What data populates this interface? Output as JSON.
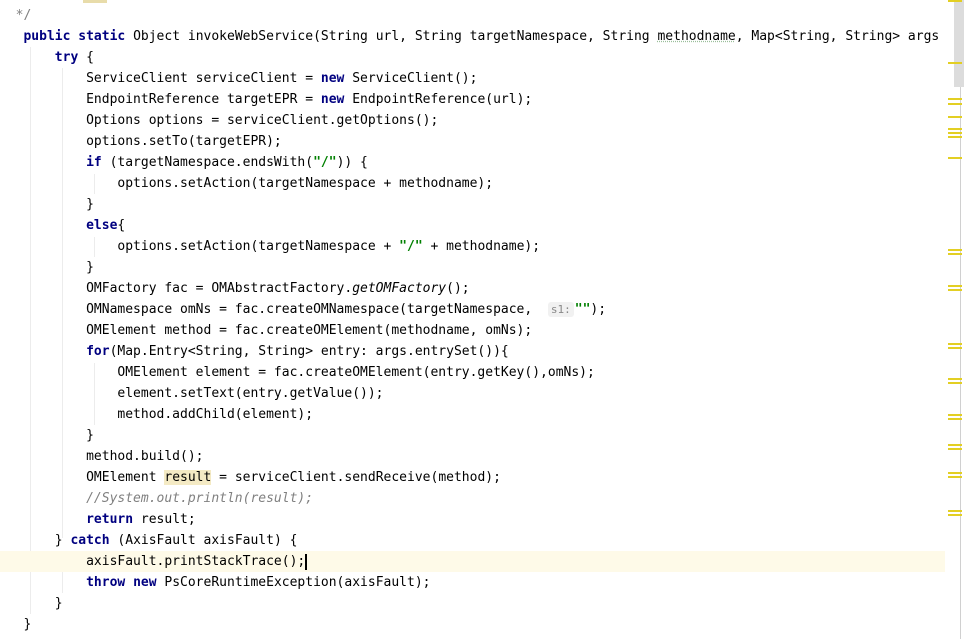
{
  "editor": {
    "current_line": 27,
    "lines": [
      [
        [
          "d",
          "  */"
        ]
      ],
      [
        [
          "p",
          "   "
        ],
        [
          "k",
          "public"
        ],
        [
          "p",
          " "
        ],
        [
          "k",
          "static"
        ],
        [
          "p",
          " Object invokeWebService(String url, String targetNamespace, String "
        ],
        [
          "u",
          "methodname"
        ],
        [
          "p",
          ", Map<String, String> args"
        ]
      ],
      [
        [
          "p",
          "       "
        ],
        [
          "k",
          "try"
        ],
        [
          "p",
          " {"
        ]
      ],
      [
        [
          "p",
          "           ServiceClient serviceClient = "
        ],
        [
          "k",
          "new"
        ],
        [
          "p",
          " ServiceClient();"
        ]
      ],
      [
        [
          "p",
          "           EndpointReference targetEPR = "
        ],
        [
          "k",
          "new"
        ],
        [
          "p",
          " EndpointReference(url);"
        ]
      ],
      [
        [
          "p",
          "           Options options = serviceClient.getOptions();"
        ]
      ],
      [
        [
          "p",
          "           options.setTo(targetEPR);"
        ]
      ],
      [
        [
          "p",
          "           "
        ],
        [
          "k",
          "if"
        ],
        [
          "p",
          " (targetNamespace.endsWith("
        ],
        [
          "s",
          "\"/\""
        ],
        [
          "p",
          ")) {"
        ]
      ],
      [
        [
          "p",
          "               options.setAction(targetNamespace + methodname);"
        ]
      ],
      [
        [
          "p",
          "           }"
        ]
      ],
      [
        [
          "p",
          "           "
        ],
        [
          "k",
          "else"
        ],
        [
          "p",
          "{"
        ]
      ],
      [
        [
          "p",
          "               options.setAction(targetNamespace + "
        ],
        [
          "s",
          "\"/\""
        ],
        [
          "p",
          " + methodname);"
        ]
      ],
      [
        [
          "p",
          "           }"
        ]
      ],
      [
        [
          "p",
          "           OMFactory fac = OMAbstractFactory."
        ],
        [
          "i",
          "getOMFactory"
        ],
        [
          "p",
          "();"
        ]
      ],
      [
        [
          "p",
          "           OMNamespace omNs = fac.createOMNamespace(targetNamespace,  "
        ],
        [
          "h",
          "s1:"
        ],
        [
          "s",
          "\"\""
        ],
        [
          "p",
          ");"
        ]
      ],
      [
        [
          "p",
          "           OMElement method = fac.createOMElement(methodname, omNs);"
        ]
      ],
      [
        [
          "p",
          "           "
        ],
        [
          "k",
          "for"
        ],
        [
          "p",
          "(Map.Entry<String, String> entry: args.entrySet()){"
        ]
      ],
      [
        [
          "p",
          "               OMElement element = fac.createOMElement(entry.getKey(),omNs);"
        ]
      ],
      [
        [
          "p",
          "               element.setText(entry.getValue());"
        ]
      ],
      [
        [
          "p",
          "               method.addChild(element);"
        ]
      ],
      [
        [
          "p",
          "           }"
        ]
      ],
      [
        [
          "p",
          "           method.build();"
        ]
      ],
      [
        [
          "p",
          "           OMElement "
        ],
        [
          "r",
          "result"
        ],
        [
          "p",
          " = serviceClient.sendReceive(method);"
        ]
      ],
      [
        [
          "p",
          "           "
        ],
        [
          "c",
          "//System.out.println(result);"
        ]
      ],
      [
        [
          "p",
          "           "
        ],
        [
          "k",
          "return"
        ],
        [
          "p",
          " result;"
        ]
      ],
      [
        [
          "p",
          "       } "
        ],
        [
          "k",
          "catch"
        ],
        [
          "p",
          " (AxisFault axisFault) {"
        ]
      ],
      [
        [
          "p",
          "           axisFault.printStackTrace();"
        ]
      ],
      [
        [
          "p",
          "           "
        ],
        [
          "k",
          "throw"
        ],
        [
          "p",
          " "
        ],
        [
          "k",
          "new"
        ],
        [
          "p",
          " PsCoreRuntimeException(axisFault);"
        ]
      ],
      [
        [
          "p",
          "       }"
        ]
      ],
      [
        [
          "p",
          "   }"
        ]
      ]
    ]
  },
  "scrollbar": {
    "marker_color": "#e3cf23"
  },
  "colors": {
    "keyword": "#000080",
    "string": "#008000",
    "comment": "#808080",
    "current_line": "#fefae8"
  }
}
